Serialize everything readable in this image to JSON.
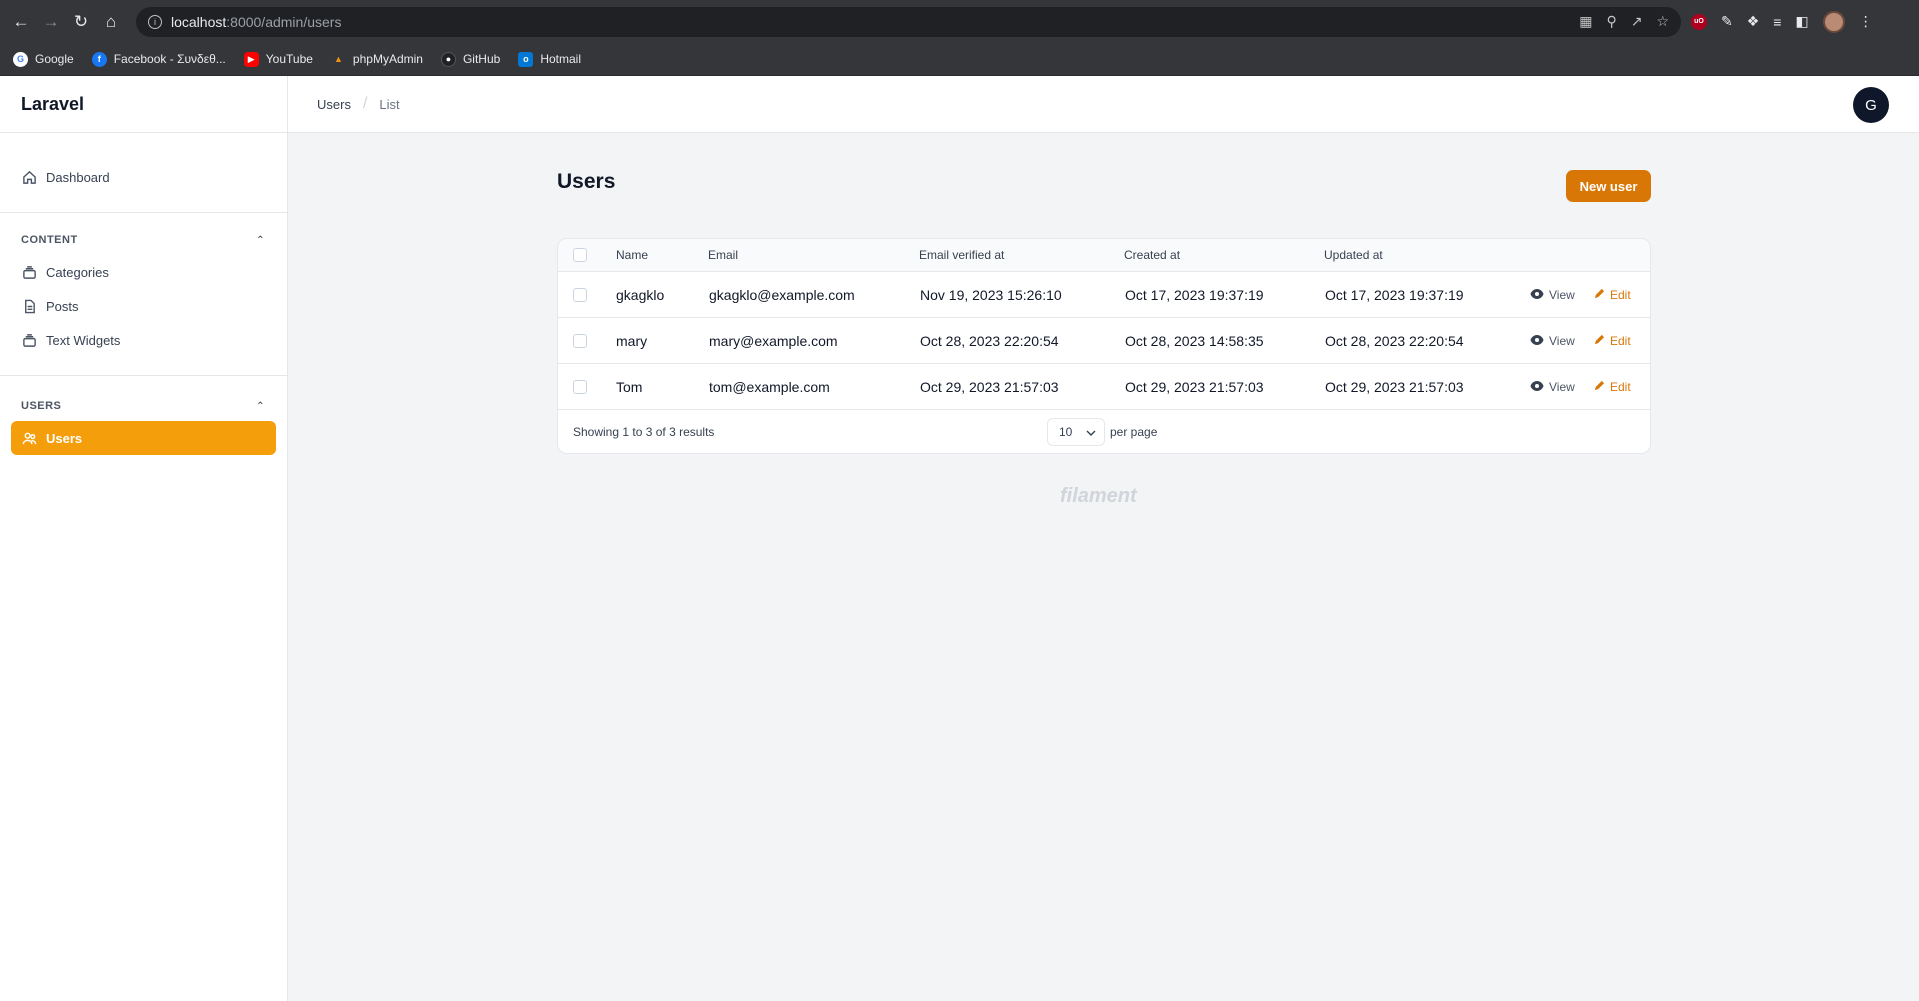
{
  "browser": {
    "url_host": "localhost",
    "url_path": ":8000/admin/users",
    "bookmarks": [
      "Google",
      "Facebook - Συνδεθ...",
      "YouTube",
      "phpMyAdmin",
      "GitHub",
      "Hotmail"
    ]
  },
  "sidebar": {
    "brand": "Laravel",
    "dashboard": "Dashboard",
    "content_group": "CONTENT",
    "content_items": [
      "Categories",
      "Posts",
      "Text Widgets"
    ],
    "users_group": "USERS",
    "users_item": "Users"
  },
  "topbar": {
    "breadcrumb": [
      "Users",
      "List"
    ],
    "avatar_initial": "G"
  },
  "main": {
    "title": "Users",
    "new_button": "New user",
    "columns": [
      "Name",
      "Email",
      "Email verified at",
      "Created at",
      "Updated at"
    ],
    "rows": [
      {
        "name": "gkagklo",
        "email": "gkagklo@example.com",
        "verified": "Nov 19, 2023 15:26:10",
        "created": "Oct 17, 2023 19:37:19",
        "updated": "Oct 17, 2023 19:37:19"
      },
      {
        "name": "mary",
        "email": "mary@example.com",
        "verified": "Oct 28, 2023 22:20:54",
        "created": "Oct 28, 2023 14:58:35",
        "updated": "Oct 28, 2023 22:20:54"
      },
      {
        "name": "Tom",
        "email": "tom@example.com",
        "verified": "Oct 29, 2023 21:57:03",
        "created": "Oct 29, 2023 21:57:03",
        "updated": "Oct 29, 2023 21:57:03"
      }
    ],
    "view_label": "View",
    "edit_label": "Edit",
    "showing": "Showing 1 to 3 of 3 results",
    "per_page_value": "10",
    "per_page_label": "per page",
    "footer_brand": "filament"
  },
  "colors": {
    "accent": "#f59e0b",
    "primary_button": "#d97706",
    "avatar": "#0f172a"
  }
}
